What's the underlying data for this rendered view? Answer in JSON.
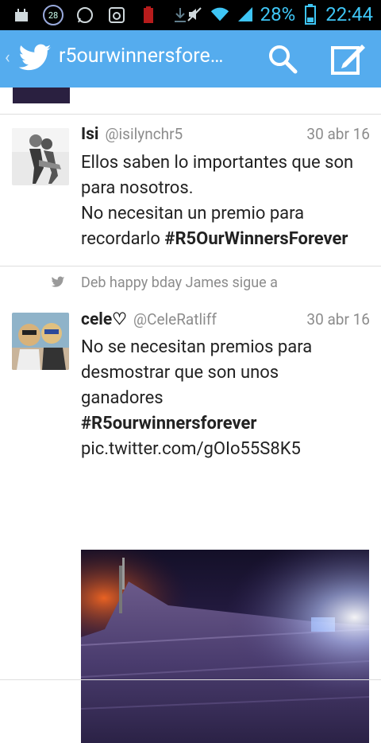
{
  "status_bar": {
    "notification_count": "28",
    "battery_percent": "28%",
    "time": "22:44"
  },
  "app_bar": {
    "title": "r5ourwinnersfore…",
    "accent_color": "#55acee"
  },
  "tweets": [
    {
      "name": "Isi",
      "handle": "@isilynchr5",
      "date": "30 abr 16",
      "lines": [
        "Ellos saben lo importantes que son",
        "para nosotros.",
        "No necesitan un premio para",
        "recordarlo "
      ],
      "hashtag": "#R5OurWinnersForever"
    },
    {
      "retweet_label": "Deb happy bday James sigue a",
      "name": "cele♡",
      "handle": "@CeleRatliff",
      "date": "30 abr 16",
      "lines": [
        "No se necesitan premios para",
        "desmostrar que son unos",
        "ganadores"
      ],
      "hashtag": "#R5ourwinnersforever",
      "link": "pic.twitter.com/gOIo55S8K5"
    }
  ]
}
